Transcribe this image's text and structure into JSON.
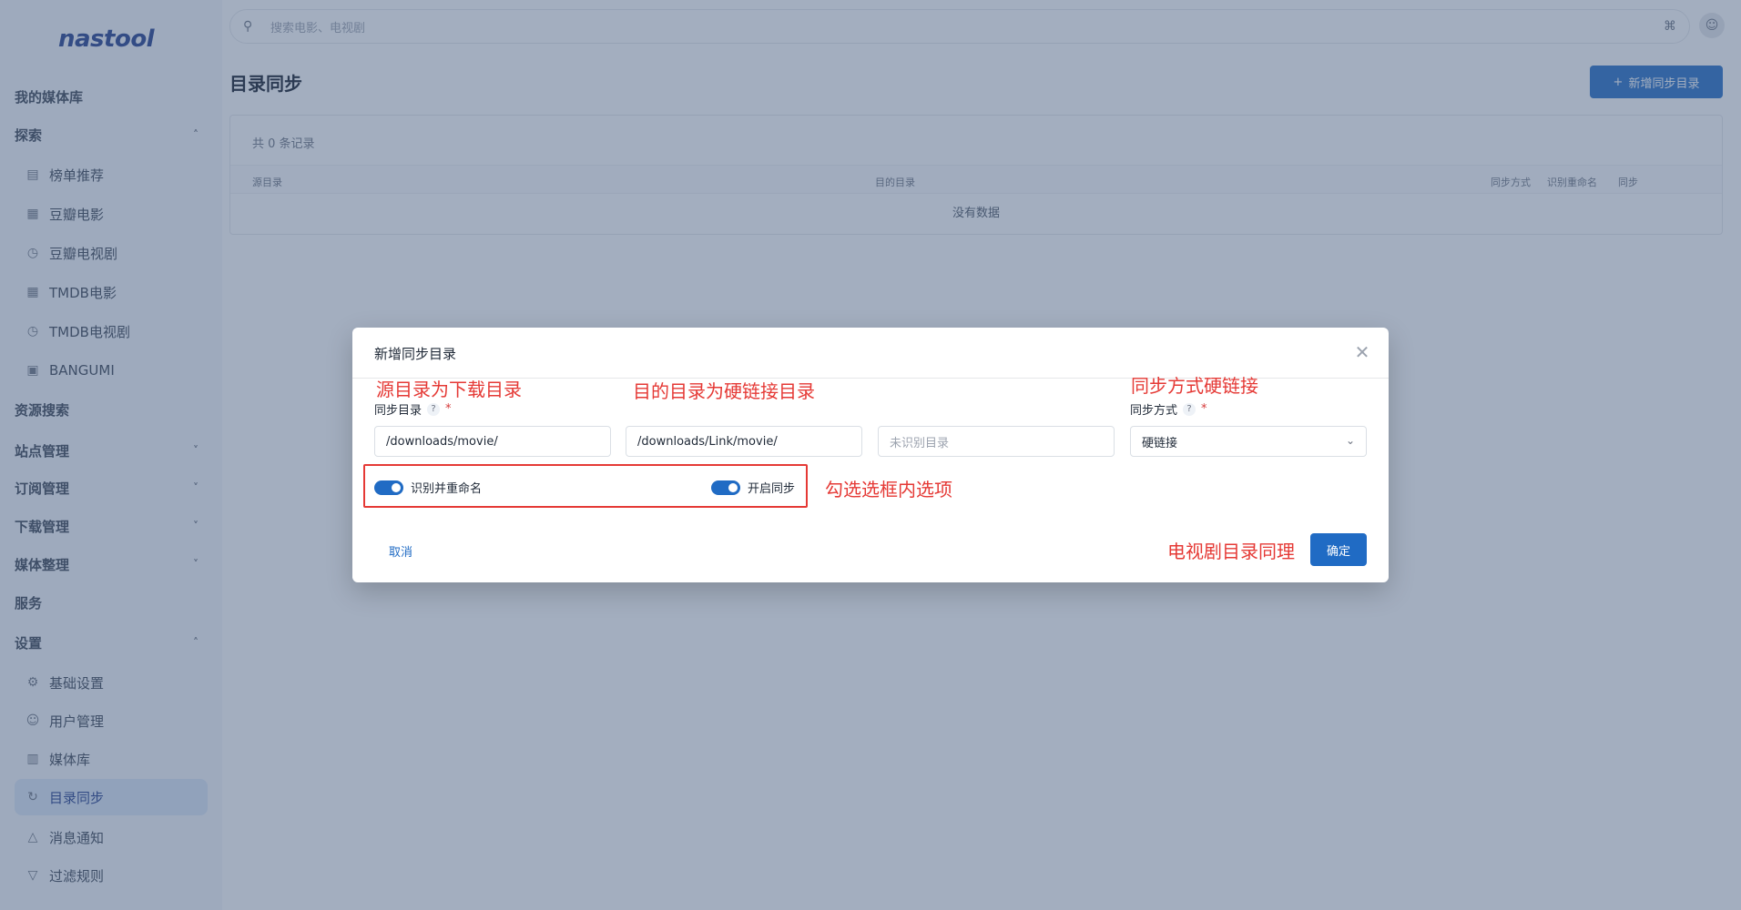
{
  "app": {
    "logo_text": "nastool"
  },
  "sidebar": {
    "items": [
      {
        "label": "我的媒体库",
        "icon": "",
        "type": "top",
        "chevron": ""
      },
      {
        "label": "探索",
        "icon": "",
        "type": "group",
        "chevron": "^"
      },
      {
        "label": "榜单推荐",
        "icon": "chart-icon",
        "type": "sub",
        "chevron": ""
      },
      {
        "label": "豆瓣电影",
        "icon": "grid-icon",
        "type": "sub",
        "chevron": ""
      },
      {
        "label": "豆瓣电视剧",
        "icon": "clock-icon",
        "type": "sub",
        "chevron": ""
      },
      {
        "label": "TMDB电影",
        "icon": "grid-icon",
        "type": "sub",
        "chevron": ""
      },
      {
        "label": "TMDB电视剧",
        "icon": "clock-icon",
        "type": "sub",
        "chevron": ""
      },
      {
        "label": "BANGUMI",
        "icon": "calendar-icon",
        "type": "sub",
        "chevron": ""
      },
      {
        "label": "资源搜索",
        "icon": "",
        "type": "top",
        "chevron": ""
      },
      {
        "label": "站点管理",
        "icon": "",
        "type": "top",
        "chevron": "v"
      },
      {
        "label": "订阅管理",
        "icon": "",
        "type": "top",
        "chevron": "v"
      },
      {
        "label": "下载管理",
        "icon": "",
        "type": "top",
        "chevron": "v"
      },
      {
        "label": "媒体整理",
        "icon": "",
        "type": "top",
        "chevron": "v"
      },
      {
        "label": "服务",
        "icon": "",
        "type": "top",
        "chevron": ""
      },
      {
        "label": "设置",
        "icon": "",
        "type": "group",
        "chevron": "^"
      },
      {
        "label": "基础设置",
        "icon": "gear-icon",
        "type": "sub",
        "chevron": ""
      },
      {
        "label": "用户管理",
        "icon": "user-icon",
        "type": "sub",
        "chevron": ""
      },
      {
        "label": "媒体库",
        "icon": "library-icon",
        "type": "sub",
        "chevron": ""
      },
      {
        "label": "目录同步",
        "icon": "sync-icon",
        "type": "sub",
        "chevron": "",
        "active": true
      },
      {
        "label": "消息通知",
        "icon": "bell-icon",
        "type": "sub",
        "chevron": ""
      },
      {
        "label": "过滤规则",
        "icon": "filter-icon",
        "type": "sub",
        "chevron": ""
      }
    ]
  },
  "topbar": {
    "search_placeholder": "搜索电影、电视剧"
  },
  "page": {
    "title": "目录同步",
    "add_button": "新增同步目录",
    "count_text": "共 0 条记录",
    "columns": [
      "源目录",
      "目的目录",
      "同步方式",
      "识别重命名",
      "同步"
    ],
    "empty_text": "没有数据"
  },
  "modal": {
    "title": "新增同步目录",
    "sync_dir_label": "同步目录",
    "sync_mode_label": "同步方式",
    "help_mark": "?",
    "required_mark": "*",
    "source_value": "/downloads/movie/",
    "dest_value": "/downloads/Link/movie/",
    "unknown_placeholder": "未识别目录",
    "sync_mode_value": "硬链接",
    "toggle_rename_label": "识别并重命名",
    "toggle_rename_on": true,
    "toggle_sync_label": "开启同步",
    "toggle_sync_on": true,
    "cancel_label": "取消",
    "ok_label": "确定"
  },
  "annotations": {
    "source_note": "源目录为下载目录",
    "dest_note": "目的目录为硬链接目录",
    "mode_note": "同步方式硬链接",
    "check_note": "勾选选框内选项",
    "tv_note": "电视剧目录同理"
  },
  "colors": {
    "primary": "#206bc4",
    "annotation_red": "#e53935",
    "overlay": "#485e80"
  }
}
